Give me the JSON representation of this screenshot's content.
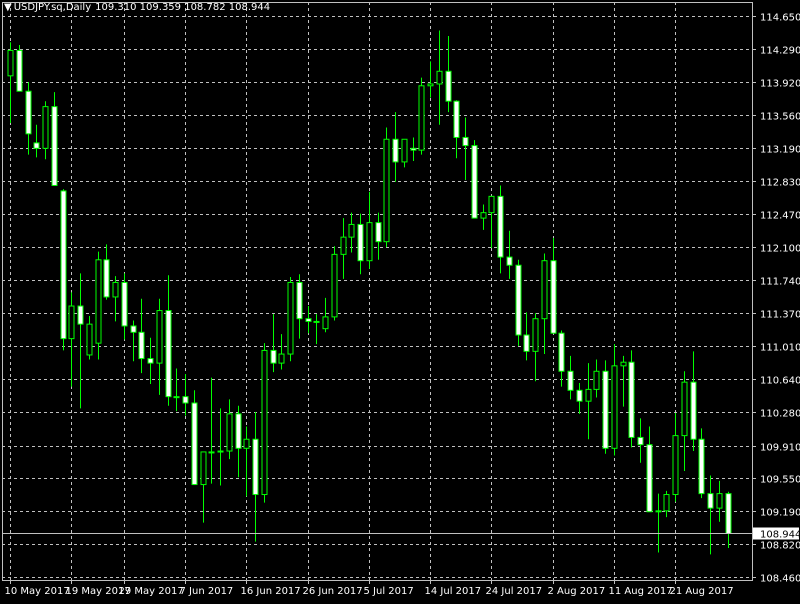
{
  "header": {
    "symbol": "USDJPY.sq,Daily",
    "ohlc": "109.310 109.359 108.782 108.944"
  },
  "colors": {
    "background": "#000000",
    "grid": "#c0c0c0",
    "candle_up_body": "#000000",
    "candle_down_body": "#ffffff",
    "candle_border": "#00ff00",
    "axis_text": "#ffffff",
    "price_line": "#c0c0c0"
  },
  "chart_data": {
    "type": "candlestick",
    "symbol": "USDJPY.sq",
    "timeframe": "Daily",
    "ylim": [
      108.46,
      114.65
    ],
    "y_ticks": [
      "114.650",
      "114.290",
      "113.920",
      "113.560",
      "113.190",
      "112.830",
      "112.470",
      "112.100",
      "111.740",
      "111.370",
      "111.010",
      "110.640",
      "110.280",
      "109.910",
      "109.550",
      "109.190",
      "108.820",
      "108.460"
    ],
    "x_ticks": [
      {
        "label": "10 May 2017",
        "index": 0
      },
      {
        "label": "19 May 2017",
        "index": 7
      },
      {
        "label": "29 May 2017",
        "index": 13
      },
      {
        "label": "7 Jun 2017",
        "index": 20
      },
      {
        "label": "16 Jun 2017",
        "index": 27
      },
      {
        "label": "26 Jun 2017",
        "index": 34
      },
      {
        "label": "5 Jul 2017",
        "index": 41
      },
      {
        "label": "14 Jul 2017",
        "index": 48
      },
      {
        "label": "24 Jul 2017",
        "index": 55
      },
      {
        "label": "2 Aug 2017",
        "index": 62
      },
      {
        "label": "11 Aug 2017",
        "index": 69
      },
      {
        "label": "21 Aug 2017",
        "index": 76
      }
    ],
    "current_price": "108.944",
    "candles": [
      {
        "o": 113.99,
        "h": 114.36,
        "l": 113.47,
        "c": 114.27
      },
      {
        "o": 114.27,
        "h": 114.33,
        "l": 113.82,
        "c": 113.82
      },
      {
        "o": 113.82,
        "h": 113.92,
        "l": 113.12,
        "c": 113.35
      },
      {
        "o": 113.25,
        "h": 113.45,
        "l": 113.09,
        "c": 113.19
      },
      {
        "o": 113.19,
        "h": 113.71,
        "l": 113.07,
        "c": 113.65
      },
      {
        "o": 113.65,
        "h": 113.81,
        "l": 112.78,
        "c": 112.78
      },
      {
        "o": 112.72,
        "h": 112.74,
        "l": 110.96,
        "c": 111.09
      },
      {
        "o": 111.09,
        "h": 111.6,
        "l": 110.56,
        "c": 111.45
      },
      {
        "o": 111.45,
        "h": 111.81,
        "l": 110.32,
        "c": 111.25
      },
      {
        "o": 110.91,
        "h": 111.34,
        "l": 110.86,
        "c": 111.25
      },
      {
        "o": 111.04,
        "h": 112.05,
        "l": 110.86,
        "c": 111.96
      },
      {
        "o": 111.96,
        "h": 112.13,
        "l": 111.52,
        "c": 111.55
      },
      {
        "o": 111.55,
        "h": 111.78,
        "l": 111.28,
        "c": 111.71
      },
      {
        "o": 111.71,
        "h": 111.81,
        "l": 111.08,
        "c": 111.23
      },
      {
        "o": 111.23,
        "h": 111.29,
        "l": 110.84,
        "c": 111.16
      },
      {
        "o": 111.16,
        "h": 111.53,
        "l": 110.71,
        "c": 110.87
      },
      {
        "o": 110.87,
        "h": 111.1,
        "l": 110.59,
        "c": 110.82
      },
      {
        "o": 110.82,
        "h": 111.53,
        "l": 110.47,
        "c": 111.4
      },
      {
        "o": 111.4,
        "h": 111.79,
        "l": 110.35,
        "c": 110.45
      },
      {
        "o": 110.45,
        "h": 110.76,
        "l": 110.29,
        "c": 110.45
      },
      {
        "o": 110.45,
        "h": 110.7,
        "l": 110.24,
        "c": 110.38
      },
      {
        "o": 110.38,
        "h": 110.52,
        "l": 109.48,
        "c": 109.48
      },
      {
        "o": 109.48,
        "h": 109.84,
        "l": 109.06,
        "c": 109.84
      },
      {
        "o": 109.84,
        "h": 110.66,
        "l": 109.49,
        "c": 109.84
      },
      {
        "o": 109.84,
        "h": 110.32,
        "l": 109.47,
        "c": 109.85
      },
      {
        "o": 109.85,
        "h": 110.42,
        "l": 109.76,
        "c": 110.26
      },
      {
        "o": 110.26,
        "h": 110.35,
        "l": 109.56,
        "c": 109.88
      },
      {
        "o": 109.88,
        "h": 110.12,
        "l": 109.35,
        "c": 109.98
      },
      {
        "o": 109.98,
        "h": 110.28,
        "l": 108.85,
        "c": 109.37
      },
      {
        "o": 109.37,
        "h": 111.04,
        "l": 109.28,
        "c": 110.96
      },
      {
        "o": 110.96,
        "h": 111.36,
        "l": 110.72,
        "c": 110.82
      },
      {
        "o": 110.82,
        "h": 111.14,
        "l": 110.75,
        "c": 110.92
      },
      {
        "o": 110.92,
        "h": 111.77,
        "l": 110.84,
        "c": 111.71
      },
      {
        "o": 111.71,
        "h": 111.8,
        "l": 111.09,
        "c": 111.31
      },
      {
        "o": 111.31,
        "h": 111.45,
        "l": 111.15,
        "c": 111.28
      },
      {
        "o": 111.28,
        "h": 111.36,
        "l": 111.03,
        "c": 111.28
      },
      {
        "o": 111.2,
        "h": 111.54,
        "l": 111.16,
        "c": 111.33
      },
      {
        "o": 111.33,
        "h": 112.11,
        "l": 111.29,
        "c": 112.02
      },
      {
        "o": 112.02,
        "h": 112.42,
        "l": 111.75,
        "c": 112.21
      },
      {
        "o": 112.21,
        "h": 112.48,
        "l": 112.04,
        "c": 112.35
      },
      {
        "o": 112.35,
        "h": 112.47,
        "l": 111.8,
        "c": 111.95
      },
      {
        "o": 111.95,
        "h": 112.71,
        "l": 111.86,
        "c": 112.37
      },
      {
        "o": 112.37,
        "h": 112.48,
        "l": 111.96,
        "c": 112.16
      },
      {
        "o": 112.16,
        "h": 113.42,
        "l": 112.1,
        "c": 113.29
      },
      {
        "o": 113.29,
        "h": 113.59,
        "l": 112.82,
        "c": 113.04
      },
      {
        "o": 113.04,
        "h": 113.29,
        "l": 112.98,
        "c": 113.29
      },
      {
        "o": 113.19,
        "h": 113.31,
        "l": 113.05,
        "c": 113.17
      },
      {
        "o": 113.17,
        "h": 113.97,
        "l": 113.12,
        "c": 113.88
      },
      {
        "o": 113.88,
        "h": 114.15,
        "l": 113.75,
        "c": 113.9
      },
      {
        "o": 113.9,
        "h": 114.49,
        "l": 113.45,
        "c": 114.04
      },
      {
        "o": 114.04,
        "h": 114.43,
        "l": 113.59,
        "c": 113.71
      },
      {
        "o": 113.71,
        "h": 113.72,
        "l": 113.08,
        "c": 113.31
      },
      {
        "o": 113.31,
        "h": 113.53,
        "l": 112.84,
        "c": 113.22
      },
      {
        "o": 113.22,
        "h": 113.28,
        "l": 112.42,
        "c": 112.42
      },
      {
        "o": 112.42,
        "h": 112.57,
        "l": 112.29,
        "c": 112.48
      },
      {
        "o": 112.48,
        "h": 112.66,
        "l": 112.09,
        "c": 112.66
      },
      {
        "o": 112.66,
        "h": 112.78,
        "l": 111.81,
        "c": 111.99
      },
      {
        "o": 111.99,
        "h": 112.28,
        "l": 111.75,
        "c": 111.9
      },
      {
        "o": 111.9,
        "h": 111.96,
        "l": 111.01,
        "c": 111.13
      },
      {
        "o": 111.13,
        "h": 111.38,
        "l": 110.85,
        "c": 110.95
      },
      {
        "o": 110.95,
        "h": 111.37,
        "l": 110.62,
        "c": 111.31
      },
      {
        "o": 111.31,
        "h": 112.03,
        "l": 110.92,
        "c": 111.95
      },
      {
        "o": 111.95,
        "h": 112.2,
        "l": 111.15,
        "c": 111.15
      },
      {
        "o": 111.15,
        "h": 111.18,
        "l": 110.56,
        "c": 110.73
      },
      {
        "o": 110.73,
        "h": 110.9,
        "l": 110.42,
        "c": 110.52
      },
      {
        "o": 110.52,
        "h": 110.6,
        "l": 110.26,
        "c": 110.4
      },
      {
        "o": 110.4,
        "h": 110.82,
        "l": 109.98,
        "c": 110.53
      },
      {
        "o": 110.53,
        "h": 110.86,
        "l": 110.44,
        "c": 110.73
      },
      {
        "o": 110.73,
        "h": 110.85,
        "l": 109.82,
        "c": 109.88
      },
      {
        "o": 109.88,
        "h": 111.03,
        "l": 109.8,
        "c": 110.79
      },
      {
        "o": 110.79,
        "h": 110.9,
        "l": 110.34,
        "c": 110.83
      },
      {
        "o": 110.83,
        "h": 110.96,
        "l": 109.89,
        "c": 110.0
      },
      {
        "o": 110.0,
        "h": 110.21,
        "l": 109.72,
        "c": 109.92
      },
      {
        "o": 109.92,
        "h": 110.12,
        "l": 109.18,
        "c": 109.18
      },
      {
        "o": 109.18,
        "h": 109.38,
        "l": 108.73,
        "c": 109.19
      },
      {
        "o": 109.19,
        "h": 109.41,
        "l": 109.12,
        "c": 109.37
      },
      {
        "o": 109.37,
        "h": 110.27,
        "l": 109.29,
        "c": 110.02
      },
      {
        "o": 110.02,
        "h": 110.73,
        "l": 109.63,
        "c": 110.61
      },
      {
        "o": 110.61,
        "h": 110.95,
        "l": 109.85,
        "c": 109.98
      },
      {
        "o": 109.98,
        "h": 110.1,
        "l": 109.33,
        "c": 109.38
      },
      {
        "o": 109.38,
        "h": 109.58,
        "l": 108.71,
        "c": 109.22
      },
      {
        "o": 109.22,
        "h": 109.52,
        "l": 109.07,
        "c": 109.38
      },
      {
        "o": 109.38,
        "h": 109.4,
        "l": 108.78,
        "c": 108.94
      }
    ]
  }
}
